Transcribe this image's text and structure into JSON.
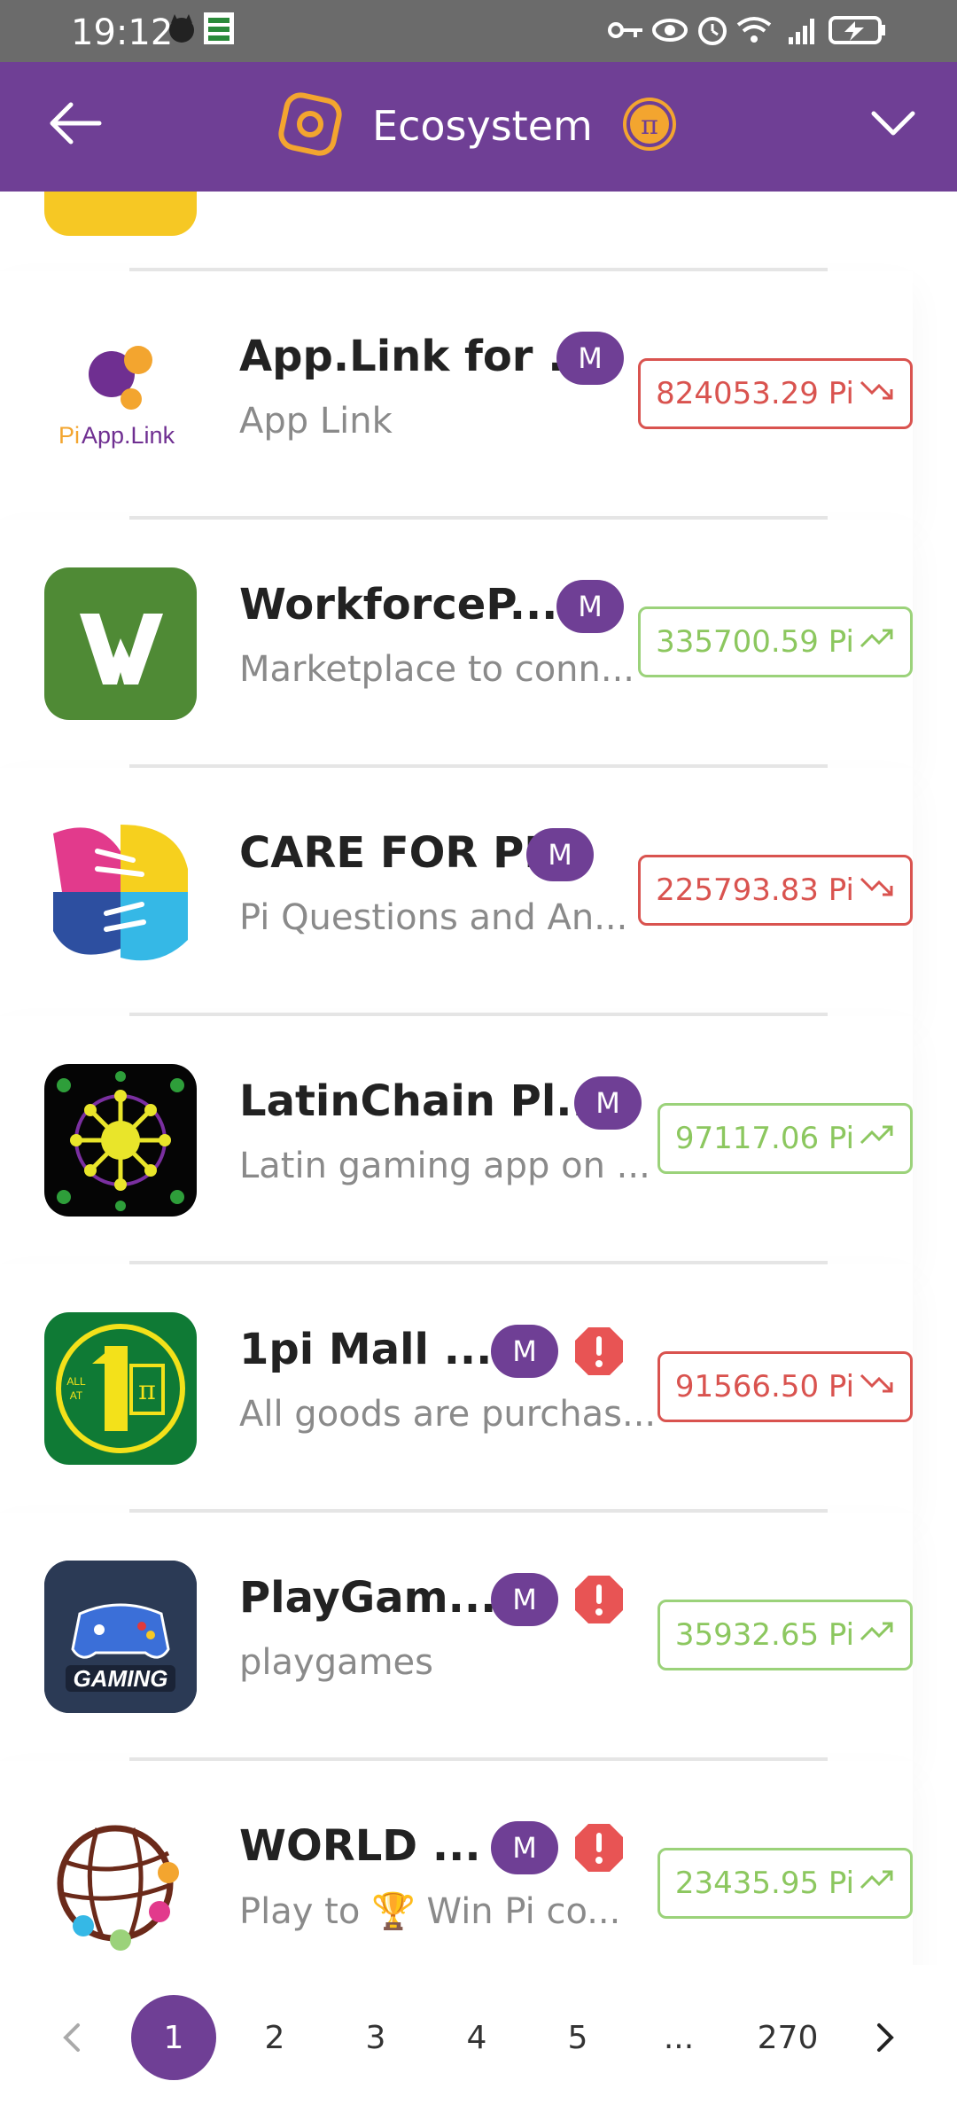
{
  "status_bar": {
    "time": "19:12"
  },
  "header": {
    "title": "Ecosystem"
  },
  "apps": [
    {
      "name": "App.Link for ...",
      "desc": "App Link",
      "badge": "M",
      "value": "824053.29 Pi",
      "trend": "down",
      "icon": "pi-app-link-logo"
    },
    {
      "name": "WorkforceP...",
      "desc": "Marketplace to conn...",
      "badge": "M",
      "value": "335700.59 Pi",
      "trend": "up",
      "icon": "workforce-w-logo"
    },
    {
      "name": "CARE FOR PI",
      "desc": "Pi Questions and An...",
      "badge": "M",
      "value": "225793.83 Pi",
      "trend": "down",
      "icon": "hands-logo"
    },
    {
      "name": "LatinChain Pl...",
      "desc": "Latin gaming app on ...",
      "badge": "M",
      "value": "97117.06 Pi",
      "trend": "up",
      "icon": "latinchain-logo"
    },
    {
      "name": "1pi Mall ...",
      "desc": "All goods are purchas...",
      "badge": "M",
      "warn": true,
      "value": "91566.50 Pi",
      "trend": "down",
      "icon": "1pi-mall-logo"
    },
    {
      "name": "PlayGam...",
      "desc": "playgames",
      "badge": "M",
      "warn": true,
      "value": "35932.65 Pi",
      "trend": "up",
      "icon": "gaming-logo"
    },
    {
      "name": "WORLD ...",
      "desc": "Play to 🏆 Win    Pi co...",
      "badge": "M",
      "warn": true,
      "value": "23435.95 Pi",
      "trend": "up",
      "icon": "world-globe-logo"
    }
  ],
  "pagination": {
    "pages": [
      "1",
      "2",
      "3",
      "4",
      "5",
      "...",
      "270"
    ],
    "current": "1"
  },
  "colors": {
    "brand": "#6f3f95",
    "down": "#d9534f",
    "up": "#8cc75f"
  }
}
